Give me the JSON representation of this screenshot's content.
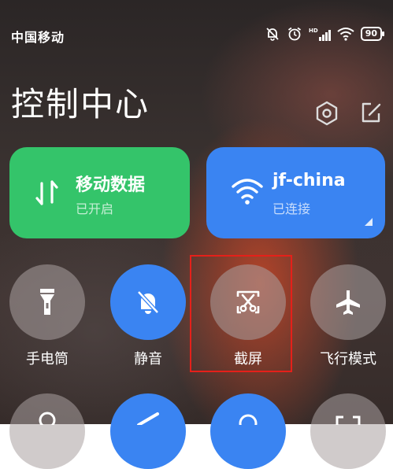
{
  "status_bar": {
    "carrier": "中国移动",
    "icons": [
      "mute-bell-icon",
      "alarm-icon",
      "hd-signal-icon",
      "wifi-icon"
    ],
    "hd_label": "HD",
    "battery": "90"
  },
  "header": {
    "title": "控制中心",
    "icons": [
      "settings-hexagon-icon",
      "edit-icon"
    ]
  },
  "tiles": [
    {
      "label": "移动数据",
      "status": "已开启",
      "icon": "mobile-data-arrows-icon",
      "color": "#34c46a"
    },
    {
      "label": "jf-china",
      "status": "已连接",
      "icon": "wifi-icon",
      "color": "#3a84f2"
    }
  ],
  "toggles": [
    {
      "label": "手电筒",
      "icon": "flashlight-icon",
      "active": false
    },
    {
      "label": "静音",
      "icon": "mute-bell-icon",
      "active": true
    },
    {
      "label": "截屏",
      "icon": "screenshot-scissors-icon",
      "active": false,
      "highlighted": true
    },
    {
      "label": "飞行模式",
      "icon": "airplane-icon",
      "active": false
    }
  ],
  "colors": {
    "accent_blue": "#3a84f2",
    "accent_green": "#34c46a",
    "highlight_red": "#e5201a"
  }
}
